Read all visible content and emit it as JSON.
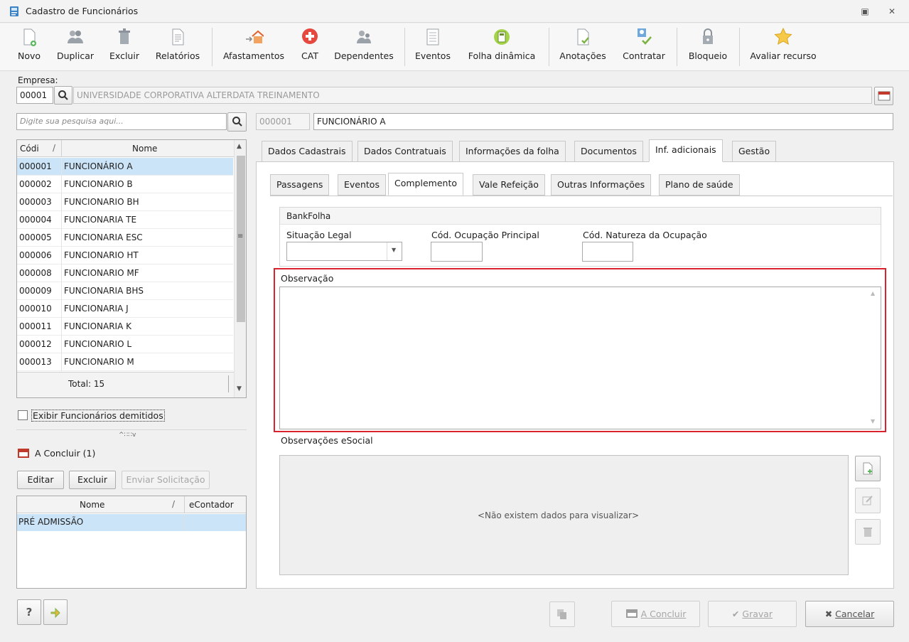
{
  "window": {
    "title": "Cadastro de Funcionários"
  },
  "toolbar": {
    "items": [
      "Novo",
      "Duplicar",
      "Excluir",
      "Relatórios",
      "Afastamentos",
      "CAT",
      "Dependentes",
      "Eventos",
      "Folha dinâmica",
      "Anotações",
      "Contratar",
      "Bloqueio",
      "Avaliar recurso"
    ]
  },
  "empresa": {
    "label": "Empresa:",
    "code": "00001",
    "name": "UNIVERSIDADE CORPORATIVA ALTERDATA TREINAMENTO"
  },
  "search": {
    "placeholder": "Digite sua pesquisa aqui..."
  },
  "selected": {
    "code": "000001",
    "name": "FUNCIONÁRIO A"
  },
  "employee_list": {
    "columns": [
      "Códi",
      "Nome"
    ],
    "rows": [
      [
        "000001",
        "FUNCIONÁRIO A"
      ],
      [
        "000002",
        "FUNCIONARIO B"
      ],
      [
        "000003",
        "FUNCIONARIO BH"
      ],
      [
        "000004",
        "FUNCIONARIA TE"
      ],
      [
        "000005",
        "FUNCIONARIA ESC"
      ],
      [
        "000006",
        "FUNCIONARIO HT"
      ],
      [
        "000008",
        "FUNCIONARIO MF"
      ],
      [
        "000009",
        "FUNCIONARIA BHS"
      ],
      [
        "000010",
        "FUNCIONARIA J"
      ],
      [
        "000011",
        "FUNCIONARIA K"
      ],
      [
        "000012",
        "FUNCIONARIO L"
      ],
      [
        "000013",
        "FUNCIONARIO M"
      ]
    ],
    "total": "Total: 15"
  },
  "show_dismissed": {
    "label": "Exibir Funcionários demitidos",
    "checked": false
  },
  "pending": {
    "title": "A Concluir (1)",
    "buttons": [
      "Editar",
      "Excluir",
      "Enviar Solicitação"
    ],
    "columns": [
      "Nome",
      "eContador"
    ],
    "rows": [
      [
        "PRÉ ADMISSÃO",
        ""
      ]
    ]
  },
  "main_tabs": [
    "Dados Cadastrais",
    "Dados Contratuais",
    "Informações da folha",
    "Documentos",
    "Inf. adicionais",
    "Gestão"
  ],
  "main_tab_active": "Inf. adicionais",
  "sub_tabs": [
    "Passagens",
    "Eventos",
    "Complemento",
    "Vale Refeição",
    "Outras Informações",
    "Plano de saúde"
  ],
  "sub_tab_active": "Complemento",
  "bankfolha": {
    "title": "BankFolha",
    "situacao_label": "Situação Legal",
    "ocupacao_label": "Cód. Ocupação Principal",
    "natureza_label": "Cód. Natureza da Ocupação"
  },
  "observacao": {
    "label": "Observação",
    "value": ""
  },
  "esocial": {
    "label": "Observações eSocial",
    "empty": "<Não existem dados para visualizar>"
  },
  "footer": {
    "a_concluir": "A Concluir",
    "gravar": "Gravar",
    "cancelar": "Cancelar",
    "help": "?"
  },
  "colors": {
    "selection": "#cce4f7",
    "highlight_border": "#d9232e"
  }
}
